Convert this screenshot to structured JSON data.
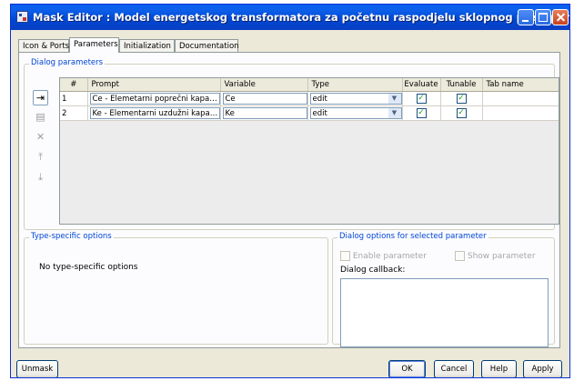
{
  "window": {
    "title": "Mask Editor : Model energetskog transformatora za početnu raspodjelu sklopnog prenapona",
    "controls": [
      "minimize-icon",
      "maximize-icon",
      "close-icon"
    ]
  },
  "tabs": [
    {
      "label": "Icon & Ports",
      "active": false
    },
    {
      "label": "Parameters",
      "active": true
    },
    {
      "label": "Initialization",
      "active": false
    },
    {
      "label": "Documentation",
      "active": false
    }
  ],
  "dialog_parameters": {
    "title": "Dialog parameters",
    "side_buttons": [
      {
        "icon": "add-parameter-icon",
        "glyph": "⇥",
        "enabled": true
      },
      {
        "icon": "copy-parameter-icon",
        "glyph": "▤",
        "enabled": false
      },
      {
        "icon": "delete-parameter-icon",
        "glyph": "✕",
        "enabled": false
      },
      {
        "icon": "move-up-icon",
        "glyph": "⤒",
        "enabled": false
      },
      {
        "icon": "move-down-icon",
        "glyph": "⤓",
        "enabled": false
      }
    ],
    "columns": [
      "#",
      "Prompt",
      "Variable",
      "Type",
      "Evaluate",
      "Tunable",
      "Tab name"
    ],
    "rows": [
      {
        "num": "1",
        "prompt": "Ce - Elemetarni poprečni kapacitet",
        "variable": "Ce",
        "type": "edit",
        "evaluate": true,
        "tunable": true,
        "tab_name": ""
      },
      {
        "num": "2",
        "prompt": "Ke - Elementarni uzdužni kapacitet",
        "variable": "Ke",
        "type": "edit",
        "evaluate": true,
        "tunable": true,
        "tab_name": ""
      }
    ]
  },
  "type_specific": {
    "title": "Type-specific options",
    "message": "No type-specific options"
  },
  "selected_param_options": {
    "title": "Dialog options for selected parameter",
    "enable_parameter": "Enable parameter",
    "show_parameter": "Show parameter",
    "callback_label": "Dialog callback:",
    "callback_value": ""
  },
  "buttons": {
    "unmask": "Unmask",
    "ok": "OK",
    "cancel": "Cancel",
    "help": "Help",
    "apply": "Apply"
  }
}
